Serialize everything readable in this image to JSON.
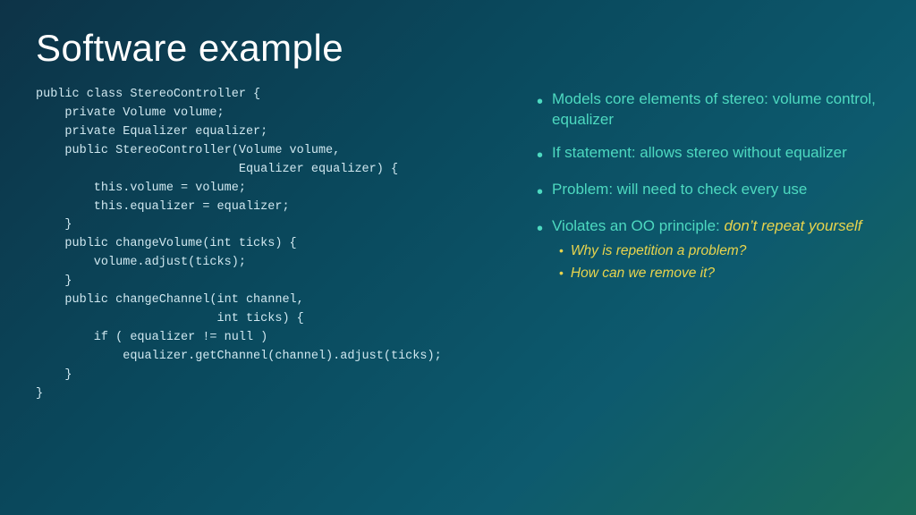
{
  "slide": {
    "title": "Software example",
    "code": "public class StereoController {\n    private Volume volume;\n    private Equalizer equalizer;\n    public StereoController(Volume volume,\n                            Equalizer equalizer) {\n        this.volume = volume;\n        this.equalizer = equalizer;\n    }\n    public changeVolume(int ticks) {\n        volume.adjust(ticks);\n    }\n    public changeChannel(int channel,\n                         int ticks) {\n        if ( equalizer != null )\n            equalizer.getChannel(channel).adjust(ticks);\n    }\n}",
    "bullets": [
      {
        "id": "bullet1",
        "text": "Models core elements of stereo: volume control, equalizer",
        "sub_bullets": []
      },
      {
        "id": "bullet2",
        "text": "If statement: allows stereo without equalizer",
        "sub_bullets": []
      },
      {
        "id": "bullet3",
        "text": "Problem: will need to check every use",
        "sub_bullets": []
      },
      {
        "id": "bullet4",
        "text": "Violates an OO principle: ",
        "italic_part": "don’t repeat yourself",
        "sub_bullets": [
          {
            "id": "sub1",
            "text": "Why is repetition a problem?"
          },
          {
            "id": "sub2",
            "text": "How can we remove it?"
          }
        ]
      }
    ]
  }
}
